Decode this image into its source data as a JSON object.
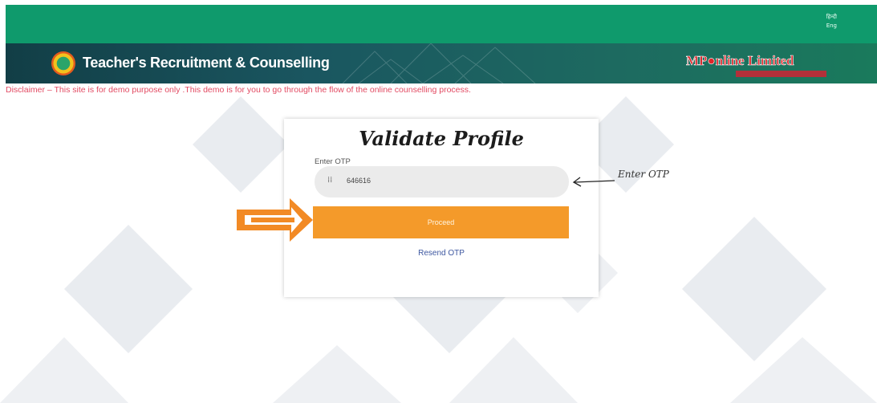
{
  "topbar": {
    "language_line1": "हिन्दी",
    "language_line2": "Eng"
  },
  "header": {
    "site_title": "Teacher's Recruitment & Counselling",
    "brand_name": "MP●nline Limited"
  },
  "disclaimer": "Disclaimer – This site is for demo purpose only .This demo is for you to go through the flow of the online counselling process.",
  "form": {
    "title": "Validate Profile",
    "otp_label": "Enter OTP",
    "otp_icon": "keypad-icon",
    "otp_value": "646616",
    "proceed_label": "Proceed",
    "resend_label": "Resend OTP"
  },
  "annotation": {
    "text": "Enter OTP"
  },
  "colors": {
    "topbar": "#0f9a6c",
    "header": "#1a5660",
    "button": "#f49a2a",
    "disclaimer": "#e24a62",
    "link": "#3d57a0"
  }
}
